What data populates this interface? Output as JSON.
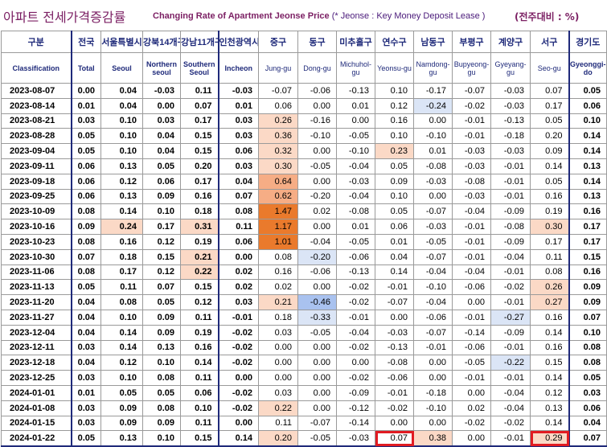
{
  "title": {
    "korean": "아파트 전세가격증감률",
    "english": "Changing Rate of Apartment Jeonse Price",
    "note": "(* Jeonse : Key Money Deposit Lease )",
    "unit": "(전주대비 : %)"
  },
  "columns": [
    {
      "ko": "구분",
      "en": "Classification"
    },
    {
      "ko": "전국",
      "en": "Total"
    },
    {
      "ko": "서울특별시",
      "en": "Seoul"
    },
    {
      "ko": "강북14개구",
      "en": "Northern seoul"
    },
    {
      "ko": "강남11개구",
      "en": "Southern Seoul"
    },
    {
      "ko": "인천광역시",
      "en": "Incheon"
    },
    {
      "ko": "중구",
      "en": "Jung-gu"
    },
    {
      "ko": "동구",
      "en": "Dong-gu"
    },
    {
      "ko": "미추홀구",
      "en": "Michuhol-gu"
    },
    {
      "ko": "연수구",
      "en": "Yeonsu-gu"
    },
    {
      "ko": "남동구",
      "en": "Namdong-gu"
    },
    {
      "ko": "부평구",
      "en": "Bupyeong-gu"
    },
    {
      "ko": "계양구",
      "en": "Gyeyang-gu"
    },
    {
      "ko": "서구",
      "en": "Seo-gu"
    },
    {
      "ko": "경기도",
      "en": "Gyeonggi-do"
    }
  ],
  "rows": [
    {
      "date": "2023-08-07",
      "values": [
        "0.00",
        "0.04",
        "-0.03",
        "0.11",
        "-0.03",
        "-0.07",
        "-0.06",
        "-0.13",
        "0.10",
        "-0.17",
        "-0.07",
        "-0.03",
        "0.07",
        "0.05"
      ]
    },
    {
      "date": "2023-08-14",
      "values": [
        "0.01",
        "0.04",
        "0.00",
        "0.07",
        "0.01",
        "0.06",
        "0.00",
        "0.01",
        "0.12",
        "-0.24",
        "-0.02",
        "-0.03",
        "0.17",
        "0.06"
      ]
    },
    {
      "date": "2023-08-21",
      "values": [
        "0.03",
        "0.10",
        "0.03",
        "0.17",
        "0.03",
        "0.26",
        "-0.16",
        "0.00",
        "0.16",
        "0.00",
        "-0.01",
        "-0.13",
        "0.05",
        "0.10"
      ]
    },
    {
      "date": "2023-08-28",
      "values": [
        "0.05",
        "0.10",
        "0.04",
        "0.15",
        "0.03",
        "0.36",
        "-0.10",
        "-0.05",
        "0.10",
        "-0.10",
        "-0.01",
        "-0.18",
        "0.20",
        "0.14"
      ]
    },
    {
      "date": "2023-09-04",
      "values": [
        "0.05",
        "0.10",
        "0.04",
        "0.15",
        "0.06",
        "0.32",
        "0.00",
        "-0.10",
        "0.23",
        "0.01",
        "-0.03",
        "-0.03",
        "0.09",
        "0.14"
      ]
    },
    {
      "date": "2023-09-11",
      "values": [
        "0.06",
        "0.13",
        "0.05",
        "0.20",
        "0.03",
        "0.30",
        "-0.05",
        "-0.04",
        "0.05",
        "-0.08",
        "-0.03",
        "-0.01",
        "0.14",
        "0.13"
      ]
    },
    {
      "date": "2023-09-18",
      "values": [
        "0.06",
        "0.12",
        "0.06",
        "0.17",
        "0.04",
        "0.64",
        "0.00",
        "-0.03",
        "0.09",
        "-0.03",
        "-0.08",
        "-0.01",
        "0.05",
        "0.14"
      ]
    },
    {
      "date": "2023-09-25",
      "values": [
        "0.06",
        "0.13",
        "0.09",
        "0.16",
        "0.07",
        "0.62",
        "-0.20",
        "-0.04",
        "0.10",
        "0.00",
        "-0.03",
        "-0.01",
        "0.16",
        "0.13"
      ]
    },
    {
      "date": "2023-10-09",
      "values": [
        "0.08",
        "0.14",
        "0.10",
        "0.18",
        "0.08",
        "1.47",
        "0.02",
        "-0.08",
        "0.05",
        "-0.07",
        "-0.04",
        "-0.09",
        "0.19",
        "0.16"
      ]
    },
    {
      "date": "2023-10-16",
      "values": [
        "0.09",
        "0.24",
        "0.17",
        "0.31",
        "0.11",
        "1.17",
        "0.00",
        "0.01",
        "0.06",
        "-0.03",
        "-0.01",
        "-0.08",
        "0.30",
        "0.17"
      ]
    },
    {
      "date": "2023-10-23",
      "values": [
        "0.08",
        "0.16",
        "0.12",
        "0.19",
        "0.06",
        "1.01",
        "-0.04",
        "-0.05",
        "0.01",
        "-0.05",
        "-0.01",
        "-0.09",
        "0.17",
        "0.17"
      ]
    },
    {
      "date": "2023-10-30",
      "values": [
        "0.07",
        "0.18",
        "0.15",
        "0.21",
        "0.00",
        "0.08",
        "-0.20",
        "-0.06",
        "0.04",
        "-0.07",
        "-0.01",
        "-0.04",
        "0.11",
        "0.15"
      ]
    },
    {
      "date": "2023-11-06",
      "values": [
        "0.08",
        "0.17",
        "0.12",
        "0.22",
        "0.02",
        "0.16",
        "-0.06",
        "-0.13",
        "0.14",
        "-0.04",
        "-0.04",
        "-0.01",
        "0.08",
        "0.16"
      ]
    },
    {
      "date": "2023-11-13",
      "values": [
        "0.05",
        "0.11",
        "0.07",
        "0.15",
        "0.02",
        "0.02",
        "0.00",
        "-0.02",
        "-0.01",
        "-0.10",
        "-0.06",
        "-0.02",
        "0.26",
        "0.09"
      ]
    },
    {
      "date": "2023-11-20",
      "values": [
        "0.04",
        "0.08",
        "0.05",
        "0.12",
        "0.03",
        "0.21",
        "-0.46",
        "-0.02",
        "-0.07",
        "-0.04",
        "0.00",
        "-0.01",
        "0.27",
        "0.09"
      ]
    },
    {
      "date": "2023-11-27",
      "values": [
        "0.04",
        "0.10",
        "0.09",
        "0.11",
        "-0.01",
        "0.18",
        "-0.33",
        "-0.01",
        "0.00",
        "-0.06",
        "-0.01",
        "-0.27",
        "0.16",
        "0.07"
      ]
    },
    {
      "date": "2023-12-04",
      "values": [
        "0.04",
        "0.14",
        "0.09",
        "0.19",
        "-0.02",
        "0.03",
        "-0.05",
        "-0.04",
        "-0.03",
        "-0.07",
        "-0.14",
        "-0.09",
        "0.14",
        "0.10"
      ]
    },
    {
      "date": "2023-12-11",
      "values": [
        "0.03",
        "0.14",
        "0.13",
        "0.16",
        "-0.02",
        "0.00",
        "0.00",
        "-0.02",
        "-0.13",
        "-0.01",
        "-0.06",
        "-0.01",
        "0.16",
        "0.08"
      ]
    },
    {
      "date": "2023-12-18",
      "values": [
        "0.04",
        "0.12",
        "0.10",
        "0.14",
        "-0.02",
        "0.00",
        "0.00",
        "0.00",
        "-0.08",
        "0.00",
        "-0.05",
        "-0.22",
        "0.15",
        "0.08"
      ]
    },
    {
      "date": "2023-12-25",
      "values": [
        "0.03",
        "0.10",
        "0.08",
        "0.11",
        "0.00",
        "0.00",
        "0.00",
        "-0.02",
        "-0.06",
        "0.00",
        "-0.01",
        "-0.01",
        "0.14",
        "0.05"
      ]
    },
    {
      "date": "2024-01-01",
      "values": [
        "0.01",
        "0.05",
        "0.05",
        "0.06",
        "-0.02",
        "0.03",
        "0.00",
        "-0.09",
        "-0.01",
        "-0.18",
        "0.00",
        "-0.04",
        "0.12",
        "0.03"
      ]
    },
    {
      "date": "2024-01-08",
      "values": [
        "0.03",
        "0.09",
        "0.08",
        "0.10",
        "-0.02",
        "0.22",
        "0.00",
        "-0.12",
        "-0.02",
        "-0.10",
        "0.02",
        "-0.04",
        "0.13",
        "0.06"
      ]
    },
    {
      "date": "2024-01-15",
      "values": [
        "0.03",
        "0.09",
        "0.09",
        "0.11",
        "0.00",
        "0.11",
        "-0.07",
        "-0.14",
        "0.00",
        "0.00",
        "-0.02",
        "-0.02",
        "0.14",
        "0.04"
      ]
    },
    {
      "date": "2024-01-22",
      "values": [
        "0.05",
        "0.13",
        "0.10",
        "0.15",
        "0.14",
        "0.20",
        "-0.05",
        "-0.03",
        "0.07",
        "0.38",
        "0.00",
        "-0.01",
        "0.29",
        "0.07"
      ]
    }
  ],
  "highlights": {
    "hl1": [
      [
        2,
        5
      ],
      [
        3,
        5
      ],
      [
        4,
        5
      ],
      [
        5,
        5
      ],
      [
        4,
        8
      ],
      [
        9,
        1
      ],
      [
        9,
        3
      ],
      [
        9,
        12
      ],
      [
        11,
        3
      ],
      [
        12,
        3
      ],
      [
        13,
        12
      ],
      [
        14,
        5
      ],
      [
        14,
        12
      ],
      [
        21,
        5
      ],
      [
        23,
        5
      ],
      [
        23,
        9
      ],
      [
        23,
        12
      ]
    ],
    "hl2": [
      [
        6,
        5
      ],
      [
        7,
        5
      ]
    ],
    "hl3": [
      [
        8,
        5
      ],
      [
        9,
        5
      ],
      [
        10,
        5
      ]
    ],
    "bl1": [
      [
        1,
        9
      ],
      [
        11,
        6
      ],
      [
        15,
        6
      ],
      [
        15,
        11
      ],
      [
        18,
        11
      ]
    ],
    "bl2": [
      [
        14,
        6
      ]
    ],
    "box": [
      [
        23,
        8
      ],
      [
        23,
        12
      ]
    ]
  },
  "colors": {
    "header_text": "#1f2a7a",
    "title_text": "#7b1f63",
    "highlight_red_box": "#e11b22"
  }
}
